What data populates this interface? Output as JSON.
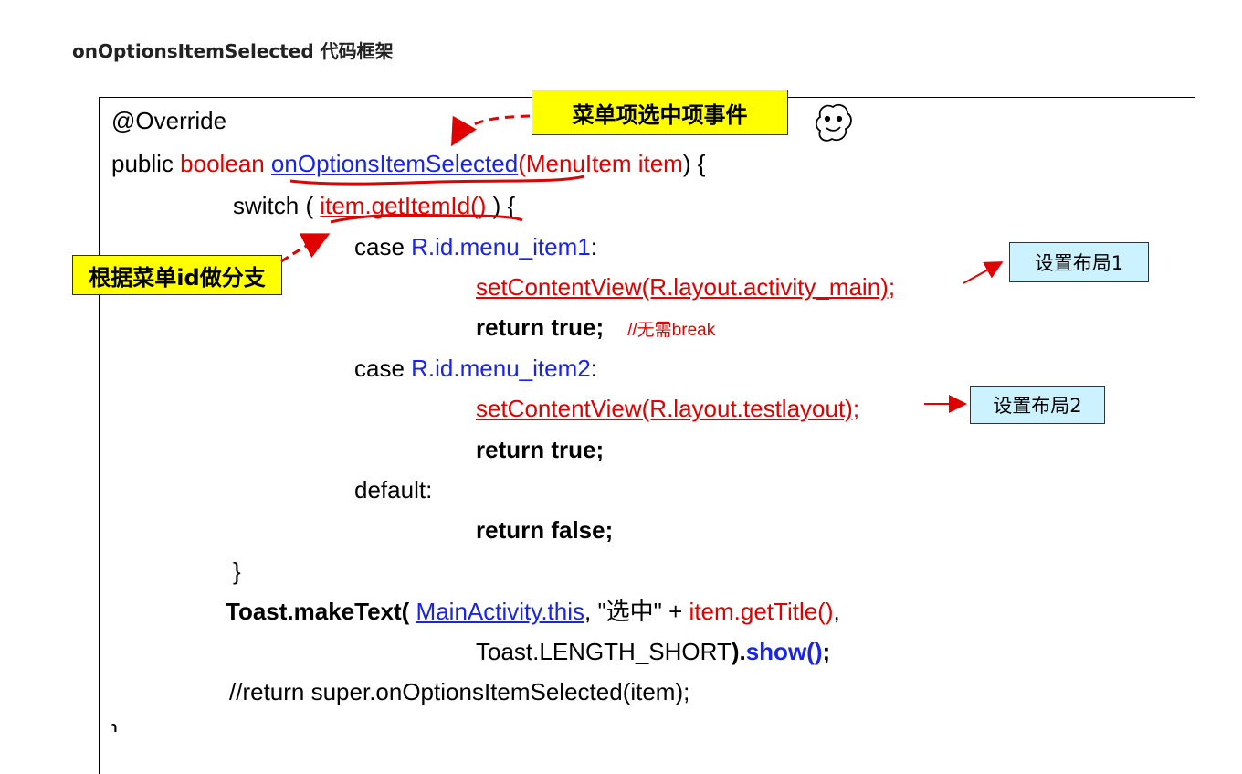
{
  "heading": "onOptionsItemSelected 代码框架",
  "callouts": {
    "menu_event": "菜单项选中项事件",
    "branch": "根据菜单id做分支",
    "layout1": "设置布局1",
    "layout2": "设置布局2"
  },
  "code": {
    "l1": "@Override",
    "l2_a": "public ",
    "l2_b": "boolean ",
    "l2_c": "onOptionsItemSelected",
    "l2_d": "(",
    "l2_e": "MenuItem item",
    "l2_f": ") {",
    "l3_a": "switch ( ",
    "l3_b": "item.getItemId()",
    "l3_c": " ) {",
    "l4_a": "case ",
    "l4_b": "R.id.menu_item1",
    "l4_c": ":",
    "l5": "setContentView(R.layout.activity_main);",
    "l6_a": "return true;",
    "l6_b": "//无需break",
    "l7_a": "case ",
    "l7_b": "R.id.menu_item2",
    "l7_c": ":",
    "l8": "setContentView(R.layout.testlayout);",
    "l9": "return true;",
    "l10": "default:",
    "l11": "return false;",
    "l12": "}",
    "l13_a": "Toast.makeText( ",
    "l13_b": "MainActivity.this",
    "l13_c": ", \"选中\" + ",
    "l13_d": "item.getTitle()",
    "l13_e": ",",
    "l14_a": "Toast.LENGTH_SHORT",
    "l14_b": ").",
    "l14_c": "show()",
    "l14_d": ";",
    "l15": "//return super.onOptionsItemSelected(item);",
    "l16": "}"
  }
}
